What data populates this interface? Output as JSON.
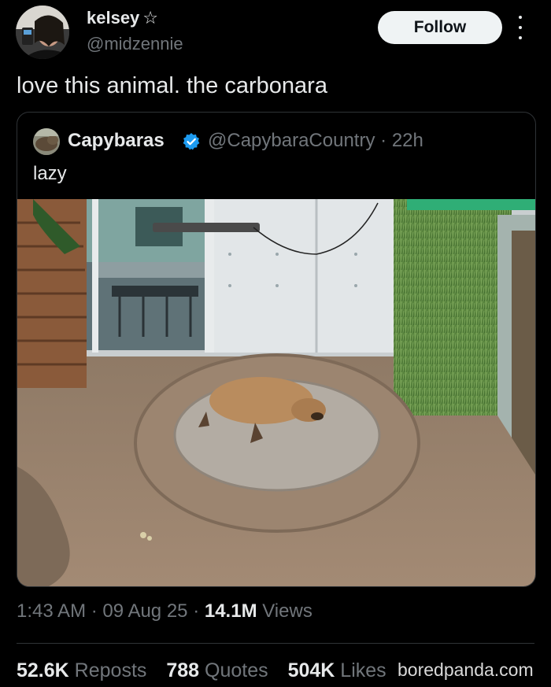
{
  "post": {
    "display_name": "kelsey",
    "name_emoji": "☆",
    "handle": "@midzennie",
    "follow_label": "Follow",
    "text": "love this animal. the carbonara"
  },
  "quoted": {
    "display_name": "Capybaras",
    "handle": "@CapybaraCountry",
    "separator": "·",
    "time": "22h",
    "text": "lazy",
    "verified_color": "#1d9bf0"
  },
  "meta": {
    "time": "1:43 AM",
    "sep1": "·",
    "date": "09 Aug 25",
    "sep2": "·",
    "views_count": "14.1M",
    "views_label": "Views"
  },
  "stats": {
    "reposts_count": "52.6K",
    "reposts_label": "Reposts",
    "quotes_count": "788",
    "quotes_label": "Quotes",
    "likes_count": "504K",
    "likes_label": "Likes"
  },
  "watermark": "boredpanda.com",
  "colors": {
    "background": "#000000",
    "text": "#e7e9ea",
    "muted": "#71767b",
    "border": "#2f3336",
    "follow_bg": "#eff3f4"
  }
}
